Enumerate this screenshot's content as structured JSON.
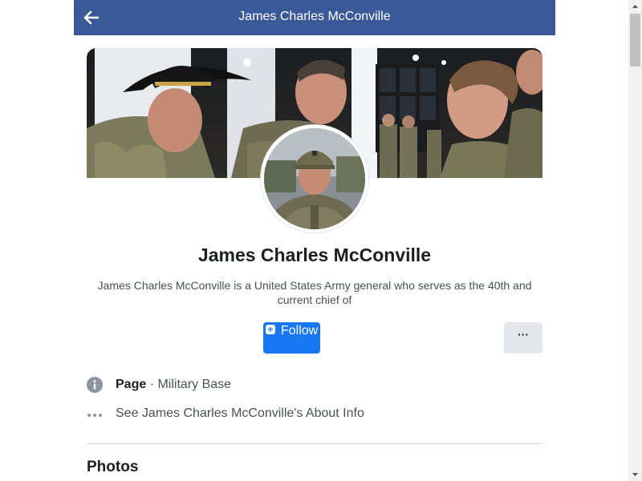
{
  "header": {
    "title": "James Charles McConville",
    "back_icon": "arrow-left-icon",
    "background": "#3b5998"
  },
  "profile": {
    "name": "James Charles McConville",
    "bio": "James Charles McConville is a United States Army general who serves as the 40th and current chief of",
    "cover_image": "cover-photo",
    "avatar_image": "profile-photo"
  },
  "actions": {
    "follow_label": "Follow",
    "follow_icon": "plus-icon",
    "follow_color": "#1877f2",
    "more_label": "···"
  },
  "info": {
    "type_label": "Page",
    "separator": " · ",
    "category": "Military Base",
    "about_link": "See James Charles McConville's About Info"
  },
  "sections": {
    "photos_title": "Photos"
  }
}
